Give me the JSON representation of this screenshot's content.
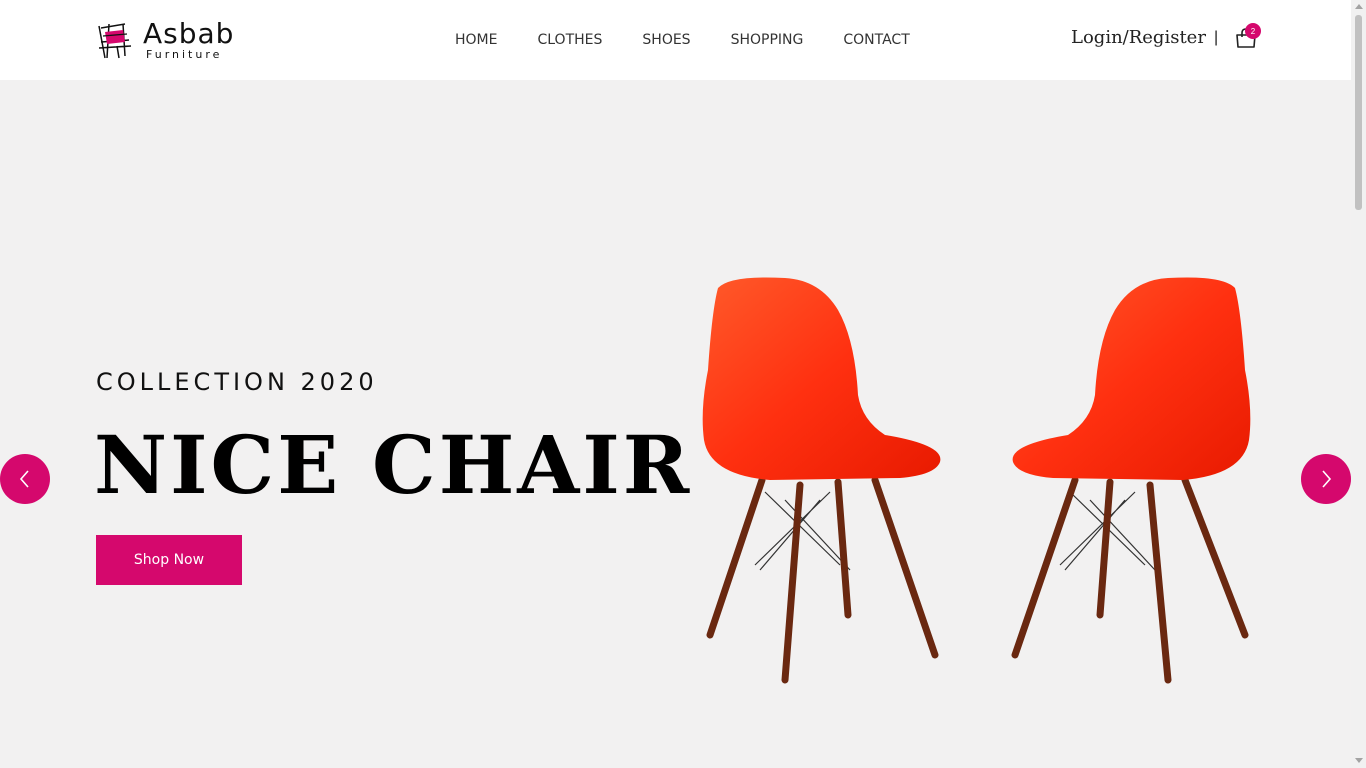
{
  "brand": {
    "name": "Asbab",
    "tagline": "Furniture"
  },
  "nav": {
    "items": [
      {
        "label": "HOME"
      },
      {
        "label": "CLOTHES"
      },
      {
        "label": "SHOES"
      },
      {
        "label": "SHOPPING"
      },
      {
        "label": "CONTACT"
      }
    ]
  },
  "account": {
    "login_label": "Login/Register",
    "divider": "|",
    "cart_count": "2"
  },
  "hero": {
    "subtitle": "COLLECTION 2020",
    "title": "NICE CHAIR",
    "cta_label": "Shop Now"
  },
  "icons": {
    "logo": "chair-logo-icon",
    "cart": "shopping-bag-icon",
    "prev": "chevron-left-icon",
    "next": "chevron-right-icon"
  },
  "colors": {
    "accent": "#d5086d",
    "background": "#f2f1f1",
    "header": "#ffffff",
    "chair_shell": "#ff3a12",
    "chair_legs": "#7a2e14"
  }
}
